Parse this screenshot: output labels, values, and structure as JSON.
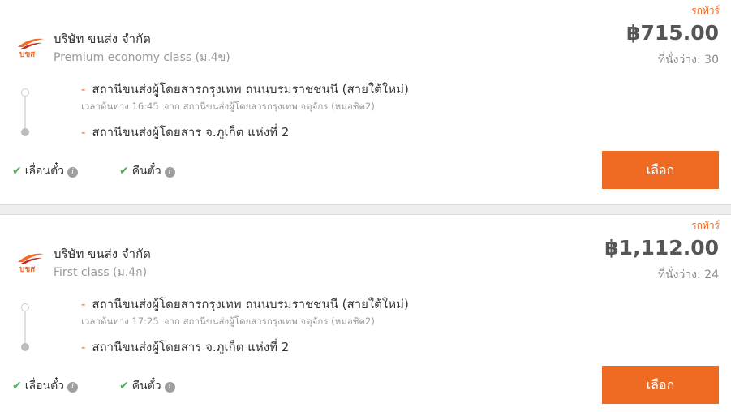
{
  "results": [
    {
      "tag": "รถทัวร์",
      "logo_text": "บขส",
      "company": "บริษัท ขนส่ง จำกัด",
      "class": "Premium economy class (ม.4ข)",
      "price": "฿715.00",
      "seats": "ที่นั่งว่าง: 30",
      "origin": "สถานีขนส่งผู้โดยสารกรุงเทพ ถนนบรมราชชนนี (สายใต้ใหม่)",
      "depart_label": "เวลาต้นทาง 16:45",
      "depart_from": "จาก สถานีขนส่งผู้โดยสารกรุงเทพ จตุจักร (หมอชิต2)",
      "destination": "สถานีขนส่งผู้โดยสาร จ.ภูเก็ต แห่งที่ 2",
      "policy_change": "เลื่อนตั๋ว",
      "policy_refund": "คืนตั๋ว",
      "button": "เลือก"
    },
    {
      "tag": "รถทัวร์",
      "logo_text": "บขส",
      "company": "บริษัท ขนส่ง จำกัด",
      "class": "First class (ม.4ก)",
      "price": "฿1,112.00",
      "seats": "ที่นั่งว่าง: 24",
      "origin": "สถานีขนส่งผู้โดยสารกรุงเทพ ถนนบรมราชชนนี (สายใต้ใหม่)",
      "depart_label": "เวลาต้นทาง 17:25",
      "depart_from": "จาก สถานีขนส่งผู้โดยสารกรุงเทพ จตุจักร (หมอชิต2)",
      "destination": "สถานีขนส่งผู้โดยสาร จ.ภูเก็ต แห่งที่ 2",
      "policy_change": "เลื่อนตั๋ว",
      "policy_refund": "คืนตั๋ว",
      "button": "เลือก"
    }
  ],
  "icons": {
    "check": "check-icon",
    "info": "info-icon",
    "logo": "bus-company-logo"
  },
  "colors": {
    "accent": "#ef6b24",
    "check": "#4caf50",
    "price": "#555555"
  }
}
